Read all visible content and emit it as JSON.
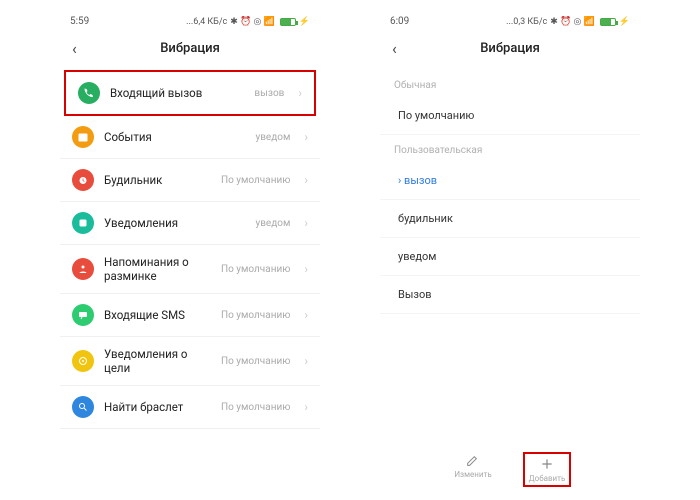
{
  "screen1": {
    "status": {
      "time": "5:59",
      "net": "...6,4 КБ/с",
      "icons": "⁂ ⏰ ✈ 📶"
    },
    "title": "Вибрация",
    "rows": [
      {
        "id": "incoming-call",
        "label": "Входящий вызов",
        "value": "вызов",
        "color": "#27ae60",
        "icon": "phone"
      },
      {
        "id": "events",
        "label": "События",
        "value": "уведом",
        "color": "#f39c12",
        "icon": "calendar"
      },
      {
        "id": "alarm",
        "label": "Будильник",
        "value": "По умолчанию",
        "color": "#e74c3c",
        "icon": "alarm"
      },
      {
        "id": "notifications",
        "label": "Уведомления",
        "value": "уведом",
        "color": "#1abc9c",
        "icon": "app"
      },
      {
        "id": "stretch-reminder",
        "label": "Напоминания о разминке",
        "value": "По умолчанию",
        "color": "#e74c3c",
        "icon": "person"
      },
      {
        "id": "incoming-sms",
        "label": "Входящие SMS",
        "value": "По умолчанию",
        "color": "#2ecc71",
        "icon": "sms"
      },
      {
        "id": "goal-notif",
        "label": "Уведомления о цели",
        "value": "По умолчанию",
        "color": "#f1c40f",
        "icon": "goal"
      },
      {
        "id": "find-band",
        "label": "Найти браслет",
        "value": "По умолчанию",
        "color": "#2e86de",
        "icon": "search"
      }
    ]
  },
  "screen2": {
    "status": {
      "time": "6:09",
      "net": "...0,3 КБ/с",
      "icons": "⁂ ⏰ ✈ 📶"
    },
    "title": "Вибрация",
    "section1": "Обычная",
    "default": "По умолчанию",
    "section2": "Пользовательская",
    "custom": [
      "вызов",
      "будильник",
      "уведом",
      "Вызов"
    ],
    "bottom": {
      "edit": "Изменить",
      "add": "Добавить"
    }
  }
}
